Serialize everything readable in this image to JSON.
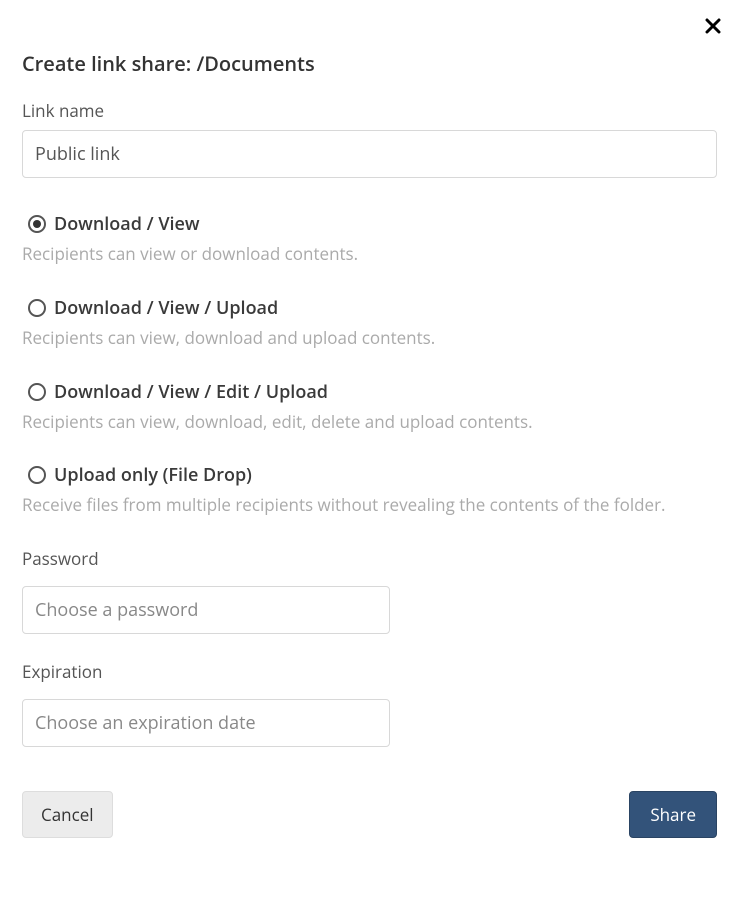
{
  "dialog": {
    "title": "Create link share: /Documents",
    "close_icon": "close"
  },
  "link_name": {
    "label": "Link name",
    "value": "Public link"
  },
  "options": [
    {
      "label": "Download / View",
      "desc": "Recipients can view or download contents.",
      "selected": true
    },
    {
      "label": "Download / View / Upload",
      "desc": "Recipients can view, download and upload contents.",
      "selected": false
    },
    {
      "label": "Download / View / Edit / Upload",
      "desc": "Recipients can view, download, edit, delete and upload contents.",
      "selected": false
    },
    {
      "label": "Upload only (File Drop)",
      "desc": "Receive files from multiple recipients without revealing the contents of the folder.",
      "selected": false
    }
  ],
  "password": {
    "label": "Password",
    "placeholder": "Choose a password",
    "value": ""
  },
  "expiration": {
    "label": "Expiration",
    "placeholder": "Choose an expiration date",
    "value": ""
  },
  "buttons": {
    "cancel": "Cancel",
    "share": "Share"
  }
}
